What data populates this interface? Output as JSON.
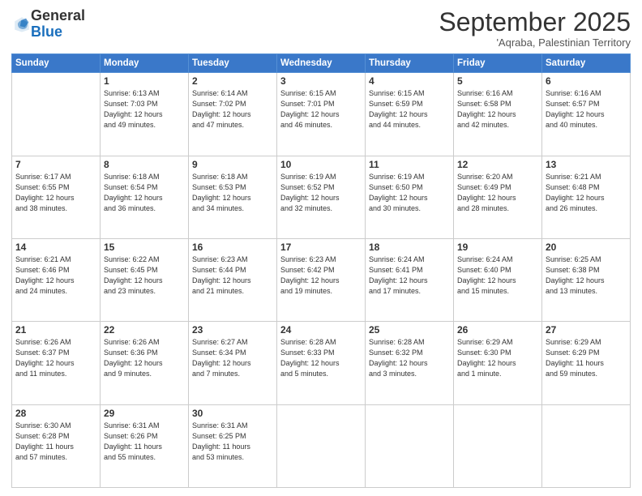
{
  "header": {
    "logo": {
      "general": "General",
      "blue": "Blue"
    },
    "title": "September 2025",
    "subtitle": "'Aqraba, Palestinian Territory"
  },
  "weekdays": [
    "Sunday",
    "Monday",
    "Tuesday",
    "Wednesday",
    "Thursday",
    "Friday",
    "Saturday"
  ],
  "weeks": [
    [
      {
        "day": "",
        "info": ""
      },
      {
        "day": "1",
        "info": "Sunrise: 6:13 AM\nSunset: 7:03 PM\nDaylight: 12 hours\nand 49 minutes."
      },
      {
        "day": "2",
        "info": "Sunrise: 6:14 AM\nSunset: 7:02 PM\nDaylight: 12 hours\nand 47 minutes."
      },
      {
        "day": "3",
        "info": "Sunrise: 6:15 AM\nSunset: 7:01 PM\nDaylight: 12 hours\nand 46 minutes."
      },
      {
        "day": "4",
        "info": "Sunrise: 6:15 AM\nSunset: 6:59 PM\nDaylight: 12 hours\nand 44 minutes."
      },
      {
        "day": "5",
        "info": "Sunrise: 6:16 AM\nSunset: 6:58 PM\nDaylight: 12 hours\nand 42 minutes."
      },
      {
        "day": "6",
        "info": "Sunrise: 6:16 AM\nSunset: 6:57 PM\nDaylight: 12 hours\nand 40 minutes."
      }
    ],
    [
      {
        "day": "7",
        "info": "Sunrise: 6:17 AM\nSunset: 6:55 PM\nDaylight: 12 hours\nand 38 minutes."
      },
      {
        "day": "8",
        "info": "Sunrise: 6:18 AM\nSunset: 6:54 PM\nDaylight: 12 hours\nand 36 minutes."
      },
      {
        "day": "9",
        "info": "Sunrise: 6:18 AM\nSunset: 6:53 PM\nDaylight: 12 hours\nand 34 minutes."
      },
      {
        "day": "10",
        "info": "Sunrise: 6:19 AM\nSunset: 6:52 PM\nDaylight: 12 hours\nand 32 minutes."
      },
      {
        "day": "11",
        "info": "Sunrise: 6:19 AM\nSunset: 6:50 PM\nDaylight: 12 hours\nand 30 minutes."
      },
      {
        "day": "12",
        "info": "Sunrise: 6:20 AM\nSunset: 6:49 PM\nDaylight: 12 hours\nand 28 minutes."
      },
      {
        "day": "13",
        "info": "Sunrise: 6:21 AM\nSunset: 6:48 PM\nDaylight: 12 hours\nand 26 minutes."
      }
    ],
    [
      {
        "day": "14",
        "info": "Sunrise: 6:21 AM\nSunset: 6:46 PM\nDaylight: 12 hours\nand 24 minutes."
      },
      {
        "day": "15",
        "info": "Sunrise: 6:22 AM\nSunset: 6:45 PM\nDaylight: 12 hours\nand 23 minutes."
      },
      {
        "day": "16",
        "info": "Sunrise: 6:23 AM\nSunset: 6:44 PM\nDaylight: 12 hours\nand 21 minutes."
      },
      {
        "day": "17",
        "info": "Sunrise: 6:23 AM\nSunset: 6:42 PM\nDaylight: 12 hours\nand 19 minutes."
      },
      {
        "day": "18",
        "info": "Sunrise: 6:24 AM\nSunset: 6:41 PM\nDaylight: 12 hours\nand 17 minutes."
      },
      {
        "day": "19",
        "info": "Sunrise: 6:24 AM\nSunset: 6:40 PM\nDaylight: 12 hours\nand 15 minutes."
      },
      {
        "day": "20",
        "info": "Sunrise: 6:25 AM\nSunset: 6:38 PM\nDaylight: 12 hours\nand 13 minutes."
      }
    ],
    [
      {
        "day": "21",
        "info": "Sunrise: 6:26 AM\nSunset: 6:37 PM\nDaylight: 12 hours\nand 11 minutes."
      },
      {
        "day": "22",
        "info": "Sunrise: 6:26 AM\nSunset: 6:36 PM\nDaylight: 12 hours\nand 9 minutes."
      },
      {
        "day": "23",
        "info": "Sunrise: 6:27 AM\nSunset: 6:34 PM\nDaylight: 12 hours\nand 7 minutes."
      },
      {
        "day": "24",
        "info": "Sunrise: 6:28 AM\nSunset: 6:33 PM\nDaylight: 12 hours\nand 5 minutes."
      },
      {
        "day": "25",
        "info": "Sunrise: 6:28 AM\nSunset: 6:32 PM\nDaylight: 12 hours\nand 3 minutes."
      },
      {
        "day": "26",
        "info": "Sunrise: 6:29 AM\nSunset: 6:30 PM\nDaylight: 12 hours\nand 1 minute."
      },
      {
        "day": "27",
        "info": "Sunrise: 6:29 AM\nSunset: 6:29 PM\nDaylight: 11 hours\nand 59 minutes."
      }
    ],
    [
      {
        "day": "28",
        "info": "Sunrise: 6:30 AM\nSunset: 6:28 PM\nDaylight: 11 hours\nand 57 minutes."
      },
      {
        "day": "29",
        "info": "Sunrise: 6:31 AM\nSunset: 6:26 PM\nDaylight: 11 hours\nand 55 minutes."
      },
      {
        "day": "30",
        "info": "Sunrise: 6:31 AM\nSunset: 6:25 PM\nDaylight: 11 hours\nand 53 minutes."
      },
      {
        "day": "",
        "info": ""
      },
      {
        "day": "",
        "info": ""
      },
      {
        "day": "",
        "info": ""
      },
      {
        "day": "",
        "info": ""
      }
    ]
  ]
}
